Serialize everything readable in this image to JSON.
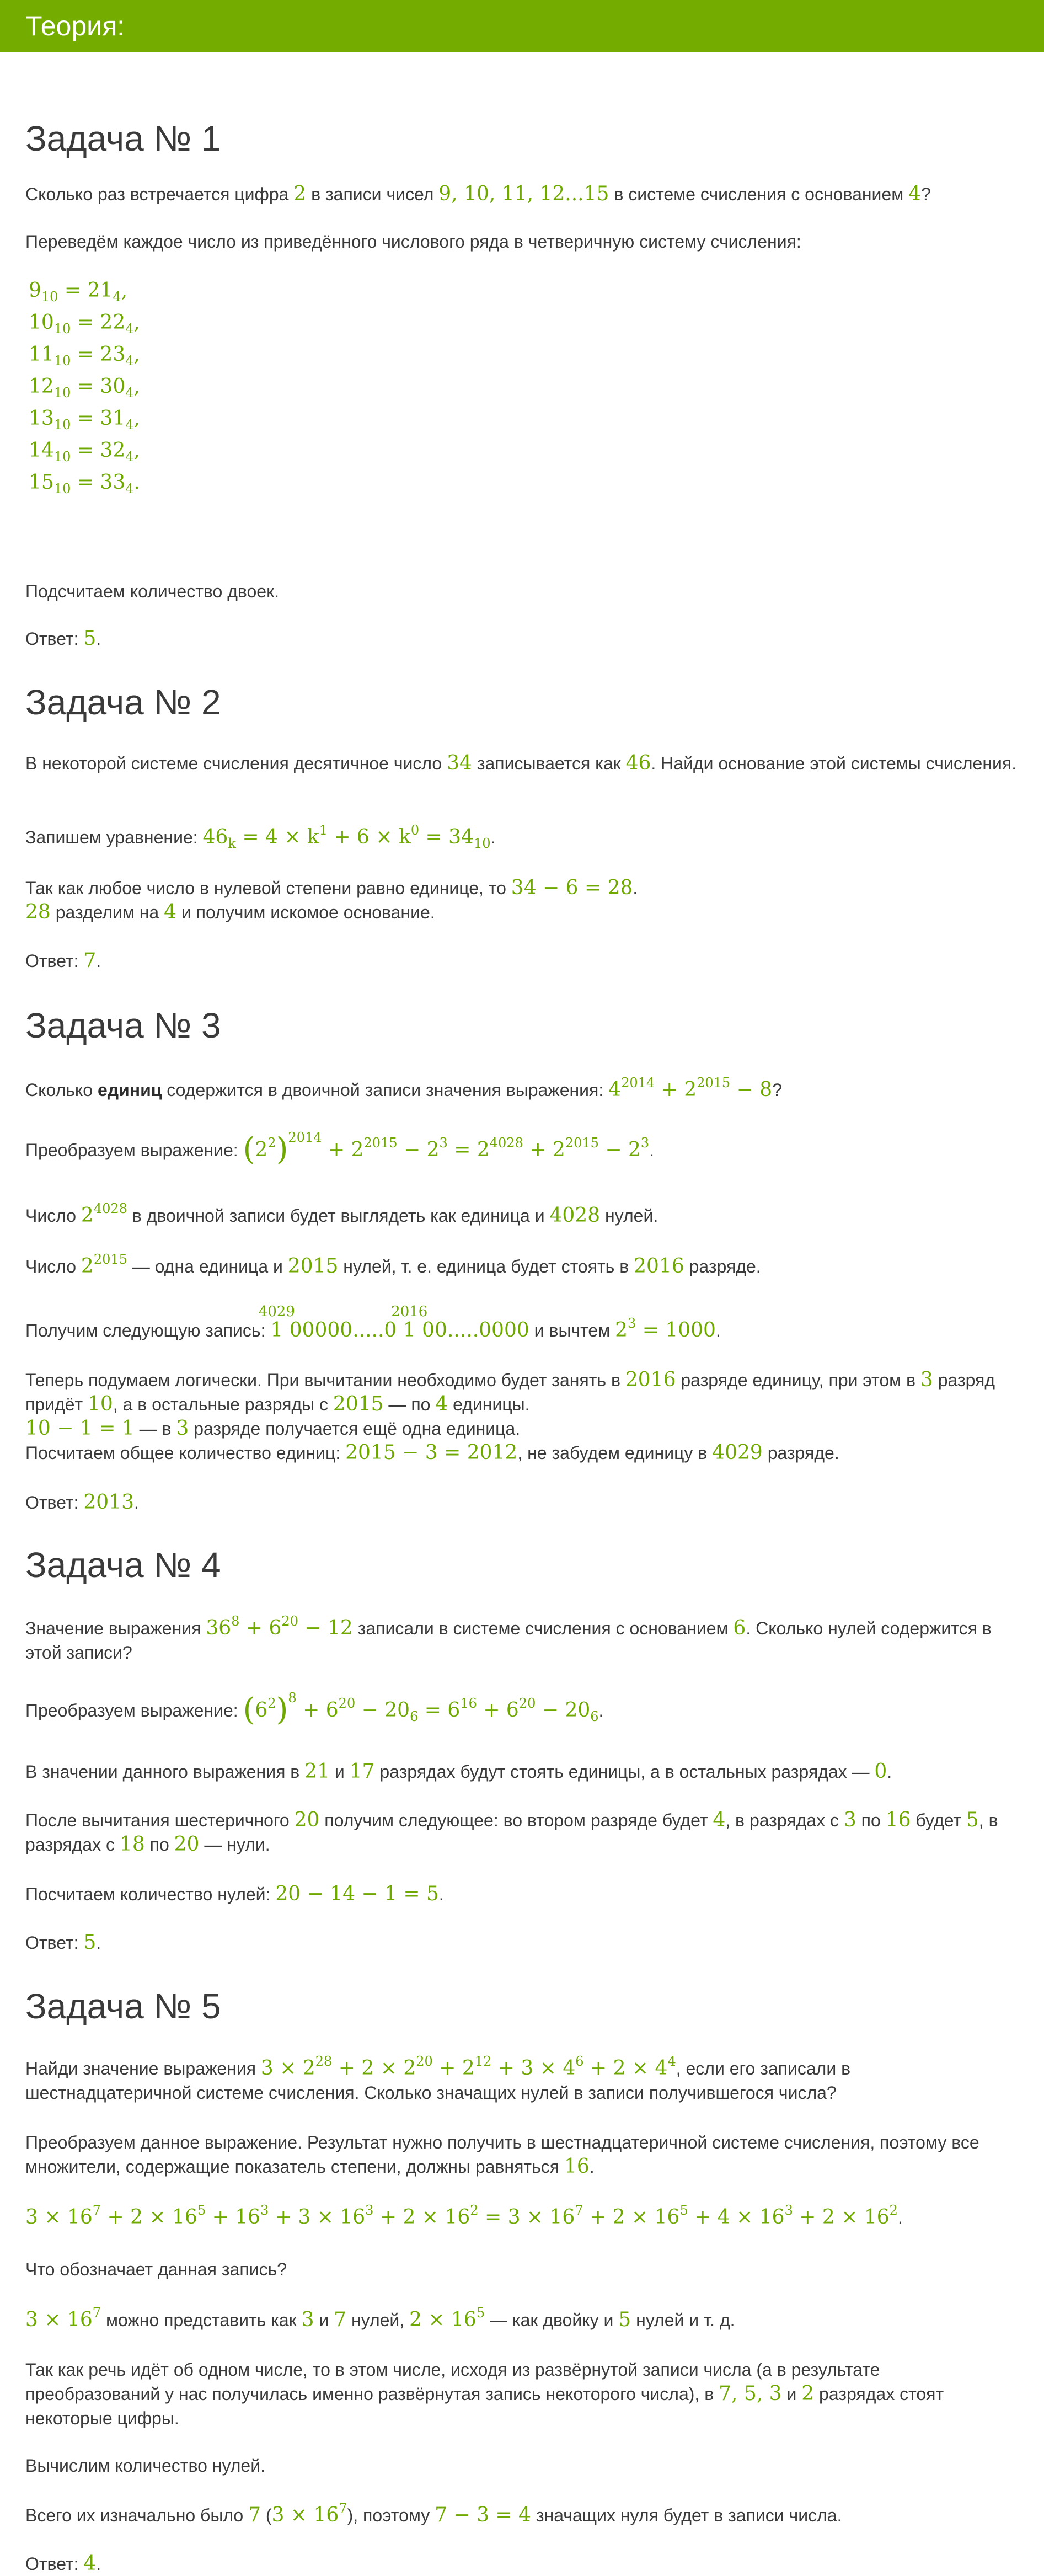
{
  "header": {
    "title": "Теория:"
  },
  "t1": {
    "title": "Задача № 1",
    "q_a": "Сколько раз встречается цифра ",
    "q_b": " в записи чисел ",
    "q_c": " в системе счисления с основанием ",
    "q_d": "?",
    "n2": "2",
    "list": "9, 10, 11, 12...15",
    "n4": "4",
    "p2": "Переведём каждое число из приведённого числового ряда в четверичную систему счисления:",
    "eqs": [
      {
        "a": "9",
        "b": "21"
      },
      {
        "a": "10",
        "b": "22"
      },
      {
        "a": "11",
        "b": "23"
      },
      {
        "a": "12",
        "b": "30"
      },
      {
        "a": "13",
        "b": "31"
      },
      {
        "a": "14",
        "b": "32"
      },
      {
        "a": "15",
        "b": "33"
      }
    ],
    "sub10": "10",
    "sub4": "4",
    "comma": ",",
    "dot": ".",
    "p3": "Подсчитаем количество двоек.",
    "ans_label": "Ответ: ",
    "ans": "5",
    "ans_end": "."
  },
  "t2": {
    "title": "Задача № 2",
    "q_a": "В некоторой системе счисления десятичное число ",
    "n34": "34",
    "q_b": " записывается как ",
    "n46": "46",
    "q_c": ". Найди основание этой системы счисления.",
    "p2": "Запишем уравнение: ",
    "p3_a": "Так как любое число в нулевой степени равно единице, то ",
    "p3_eq": "34 − 6 = 28",
    "p3_b": ".",
    "p4_n": "28",
    "p4_a": " разделим на ",
    "p4_4": "4",
    "p4_b": " и получим искомое основание.",
    "ans_label": "Ответ: ",
    "ans": "7",
    "ans_end": "."
  },
  "t3": {
    "title": "Задача № 3",
    "q_a": "Сколько ",
    "q_bold": "единиц",
    "q_b": " содержится в двоичной записи значения выражения: ",
    "p2": "Преобразуем выражение: ",
    "p3_a": "Число ",
    "p3_b": " в двоичной записи будет выглядеть как единица и ",
    "p3_n": "4028",
    "p3_c": " нулей.",
    "p4_a": "Число ",
    "p4_b": " — одна единица и ",
    "p4_n": "2015",
    "p4_c": " нулей, т. е. единица будет стоять в ",
    "p4_n2": "2016",
    "p4_d": " разряде.",
    "p5_a": "Получим следующую запись: ",
    "p5_over1": "4029",
    "p5_over2": "2016",
    "p5_d1": "1",
    "p5_z1": " 00000.....0 ",
    "p5_d2": "1",
    "p5_z2": " 00.....0000",
    "p5_b": " и вычтем ",
    "p5_eq": "= 1000",
    "p5_c": ".",
    "p6_a": "Теперь подумаем логически. При вычитании необходимо будет занять в ",
    "p6_n1": "2016",
    "p6_b": " разряде единицу, при этом в ",
    "p6_n2": "3",
    "p6_c": " разряд придёт ",
    "p6_n3": "10",
    "p6_d": ", а в остальные разряды с ",
    "p6_n4": "2015",
    "p6_e": " — по ",
    "p6_n5": "4",
    "p6_f": " единицы.",
    "p7_eq": "10 − 1 = 1",
    "p7_a": " — в ",
    "p7_n": "3",
    "p7_b": " разряде получается ещё одна единица.",
    "p8_a": "Посчитаем общее количество единиц: ",
    "p8_eq": "2015 − 3 = 2012",
    "p8_b": ", не забудем единицу в ",
    "p8_n": "4029",
    "p8_c": " разряде.",
    "ans_label": "Ответ: ",
    "ans": "2013",
    "ans_end": "."
  },
  "t4": {
    "title": "Задача № 4",
    "q_a": "Значение выражения ",
    "q_b": " записали в системе счисления с основанием ",
    "q_n": "6",
    "q_c": ". Сколько нулей содержится в этой записи?",
    "p2": "Преобразуем выражение: ",
    "p3_a": "В значении данного выражения в ",
    "p3_n1": "21",
    "p3_b": " и ",
    "p3_n2": "17",
    "p3_c": " разрядах будут стоять единицы, а в остальных разрядах — ",
    "p3_n3": "0",
    "p3_d": ".",
    "p4_a": "После вычитания шестеричного ",
    "p4_n1": "20",
    "p4_b": " получим следующее: во втором разряде будет ",
    "p4_n2": "4",
    "p4_c": ", в разрядах с ",
    "p4_n3": "3",
    "p4_d": " по ",
    "p4_n4": "16",
    "p4_e": " будет ",
    "p4_n5": "5",
    "p4_f": ", в разрядах с ",
    "p4_n6": "18",
    "p4_g": " по ",
    "p4_n7": "20",
    "p4_h": " — нули.",
    "p5_a": "Посчитаем количество нулей: ",
    "p5_eq": "20 − 14 − 1 = 5",
    "p5_b": ".",
    "ans_label": "Ответ: ",
    "ans": "5",
    "ans_end": "."
  },
  "t5": {
    "title": "Задача № 5",
    "q_a": "Найди значение выражения ",
    "q_b": ", если его записали в шестнадцатеричной системе счисления. Сколько значащих нулей в записи получившегося числа?",
    "p2_a": "Преобразуем данное выражение. Результат нужно получить в шестнадцатеричной системе счисления, поэтому все множители, содержащие показатель степени, должны равняться ",
    "p2_n": "16",
    "p2_b": ".",
    "p4": "Что обозначает данная запись?",
    "p5_a": " можно представить как ",
    "p5_n1": "3",
    "p5_b": " и ",
    "p5_n2": "7",
    "p5_c": " нулей, ",
    "p5_d": " — как двойку и ",
    "p5_n3": "5",
    "p5_e": " нулей и т. д.",
    "p6_a": "Так как речь идёт об одном числе, то в этом числе, исходя из развёрнутой записи числа (а в результате преобразований у нас получилась именно развёрнутая запись некоторого числа), в ",
    "p6_n": "7, 5, 3",
    "p6_b": " и ",
    "p6_n2": "2",
    "p6_c": " разрядах стоят некоторые цифры.",
    "p7": "Вычислим количество нулей.",
    "p8_a": "Всего их изначально было ",
    "p8_n": "7",
    "p8_b": " (",
    "p8_c": "), поэтому ",
    "p8_eq": "7 − 3 = 4",
    "p8_d": " значащих нуля будет в записи числа.",
    "ans_label": "Ответ: ",
    "ans": "4",
    "ans_end": "."
  }
}
